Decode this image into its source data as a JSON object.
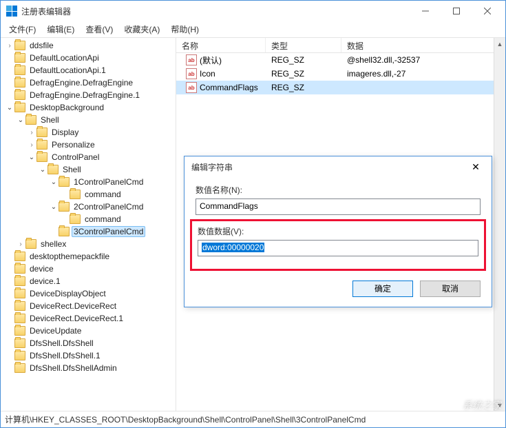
{
  "window": {
    "title": "注册表编辑器"
  },
  "menu": {
    "file": "文件(F)",
    "edit": "编辑(E)",
    "view": "查看(V)",
    "favorites": "收藏夹(A)",
    "help": "帮助(H)"
  },
  "tree": {
    "items": [
      {
        "d": 0,
        "t": "closed",
        "l": "ddsfile"
      },
      {
        "d": 0,
        "t": "none",
        "l": "DefaultLocationApi"
      },
      {
        "d": 0,
        "t": "none",
        "l": "DefaultLocationApi.1"
      },
      {
        "d": 0,
        "t": "none",
        "l": "DefragEngine.DefragEngine"
      },
      {
        "d": 0,
        "t": "none",
        "l": "DefragEngine.DefragEngine.1"
      },
      {
        "d": 0,
        "t": "open",
        "l": "DesktopBackground"
      },
      {
        "d": 1,
        "t": "open",
        "l": "Shell"
      },
      {
        "d": 2,
        "t": "closed",
        "l": "Display"
      },
      {
        "d": 2,
        "t": "closed",
        "l": "Personalize"
      },
      {
        "d": 2,
        "t": "open",
        "l": "ControlPanel"
      },
      {
        "d": 3,
        "t": "open",
        "l": "Shell"
      },
      {
        "d": 4,
        "t": "open",
        "l": "1ControlPanelCmd"
      },
      {
        "d": 5,
        "t": "none",
        "l": "command"
      },
      {
        "d": 4,
        "t": "open",
        "l": "2ControlPanelCmd"
      },
      {
        "d": 5,
        "t": "none",
        "l": "command"
      },
      {
        "d": 4,
        "t": "none",
        "l": "3ControlPanelCmd",
        "sel": true
      },
      {
        "d": 1,
        "t": "closed",
        "l": "shellex"
      },
      {
        "d": 0,
        "t": "none",
        "l": "desktopthemepackfile"
      },
      {
        "d": 0,
        "t": "none",
        "l": "device"
      },
      {
        "d": 0,
        "t": "none",
        "l": "device.1"
      },
      {
        "d": 0,
        "t": "none",
        "l": "DeviceDisplayObject"
      },
      {
        "d": 0,
        "t": "none",
        "l": "DeviceRect.DeviceRect"
      },
      {
        "d": 0,
        "t": "none",
        "l": "DeviceRect.DeviceRect.1"
      },
      {
        "d": 0,
        "t": "none",
        "l": "DeviceUpdate"
      },
      {
        "d": 0,
        "t": "none",
        "l": "DfsShell.DfsShell"
      },
      {
        "d": 0,
        "t": "none",
        "l": "DfsShell.DfsShell.1"
      },
      {
        "d": 0,
        "t": "none",
        "l": "DfsShell.DfsShellAdmin"
      }
    ]
  },
  "list": {
    "headers": {
      "name": "名称",
      "type": "类型",
      "data": "数据"
    },
    "rows": [
      {
        "name": "(默认)",
        "type": "REG_SZ",
        "data": "@shell32.dll,-32537",
        "sel": false
      },
      {
        "name": "Icon",
        "type": "REG_SZ",
        "data": "imageres.dll,-27",
        "sel": false
      },
      {
        "name": "CommandFlags",
        "type": "REG_SZ",
        "data": "",
        "sel": true
      }
    ]
  },
  "dialog": {
    "title": "编辑字符串",
    "name_label": "数值名称(N):",
    "name_value": "CommandFlags",
    "data_label": "数值数据(V):",
    "data_value": "dword:00000020",
    "ok": "确定",
    "cancel": "取消"
  },
  "status": {
    "path": "计算机\\HKEY_CLASSES_ROOT\\DesktopBackground\\Shell\\ControlPanel\\Shell\\3ControlPanelCmd"
  },
  "watermark": "系统之家"
}
